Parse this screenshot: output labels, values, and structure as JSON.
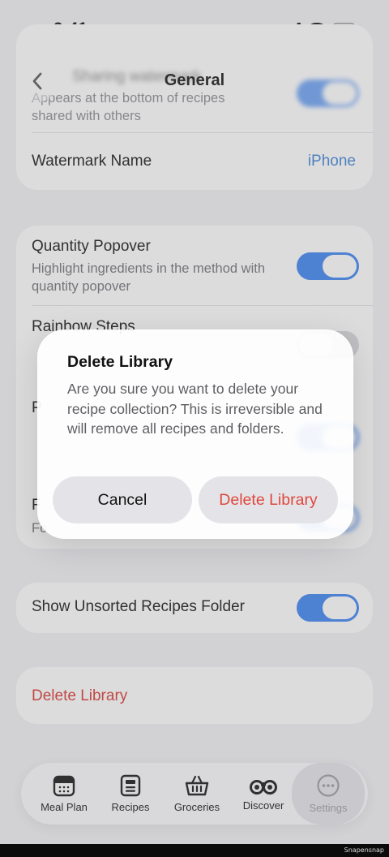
{
  "status_bar": {
    "time": "9:41"
  },
  "nav": {
    "title": "General"
  },
  "watermark_card": {
    "blurred_title": "Sharing watermark",
    "description": "Appears at the bottom of recipes shared with others",
    "name_label": "Watermark Name",
    "name_value": "iPhone"
  },
  "options_card": {
    "quantity_title": "Quantity Popover",
    "quantity_desc": "Highlight ingredients in the method with quantity popover",
    "rainbow_title": "Rainbow Steps",
    "hidden_row1_initial": "P",
    "hidden_row2_initial": "F",
    "hidden_row2_sub": "Fo"
  },
  "unsorted_card": {
    "label": "Show Unsorted Recipes Folder"
  },
  "danger_card": {
    "label": "Delete Library"
  },
  "dialog": {
    "title": "Delete Library",
    "message": "Are you sure you want to delete your recipe collection? This is irreversible and will remove all recipes and folders.",
    "cancel": "Cancel",
    "confirm": "Delete Library"
  },
  "tabbar": {
    "tabs": [
      {
        "label": "Meal Plan",
        "icon": "calendar-icon"
      },
      {
        "label": "Recipes",
        "icon": "recipe-card-icon"
      },
      {
        "label": "Groceries",
        "icon": "basket-icon"
      },
      {
        "label": "Discover",
        "icon": "binoculars-icon"
      },
      {
        "label": "Settings",
        "icon": "more-icon"
      }
    ]
  },
  "watermark_footer": "Snapensnap",
  "colors": {
    "accent": "#3a82f0",
    "link": "#3b82d6",
    "danger": "#d9342b",
    "background": "#f2f2f4"
  }
}
